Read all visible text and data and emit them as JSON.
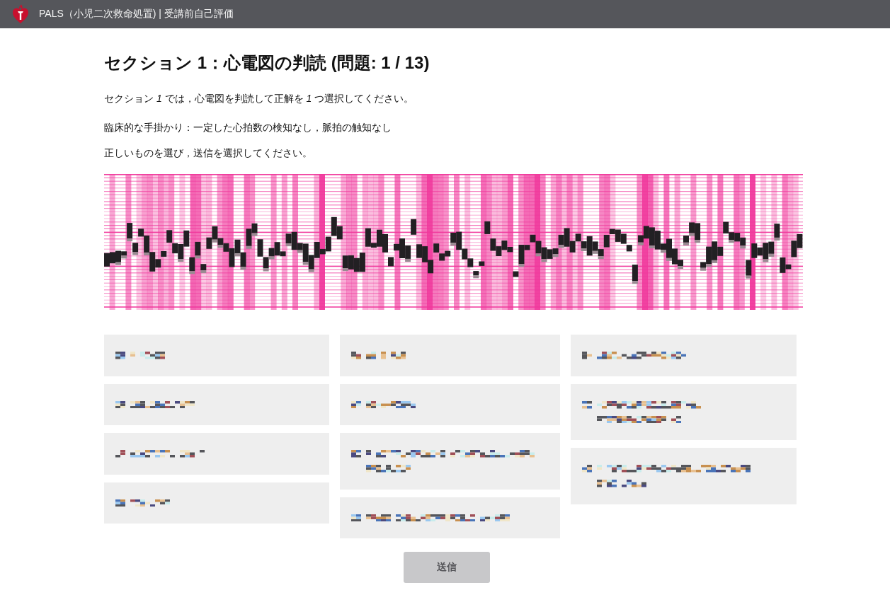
{
  "header": {
    "title": "PALS（小児二次救命処置) | 受講前自己評価"
  },
  "heading": "セクション 1：心電図の判読 (問題: 1 / 13)",
  "instructions": [
    "セクション *1* では，心電図を判読して正解を *1* つ選択してください。",
    "臨床的な手掛かり：一定した心拍数の検知なし，脈拍の触知なし",
    "正しいものを選び，送信を選択してください。"
  ],
  "answer_columns": [
    {
      "options": [
        {
          "kind": "single-line",
          "selected": false
        },
        {
          "kind": "single-line",
          "selected": false
        },
        {
          "kind": "single-line",
          "selected": false
        },
        {
          "kind": "single-line",
          "selected": false
        }
      ]
    },
    {
      "options": [
        {
          "kind": "single-line",
          "selected": false
        },
        {
          "kind": "single-line",
          "selected": false
        },
        {
          "kind": "two-line",
          "selected": false
        },
        {
          "kind": "single-line",
          "selected": false
        }
      ]
    },
    {
      "options": [
        {
          "kind": "single-line",
          "selected": false
        },
        {
          "kind": "two-line",
          "selected": false
        },
        {
          "kind": "two-line",
          "selected": false
        }
      ]
    }
  ],
  "submit": {
    "label": "送信",
    "disabled": true
  }
}
